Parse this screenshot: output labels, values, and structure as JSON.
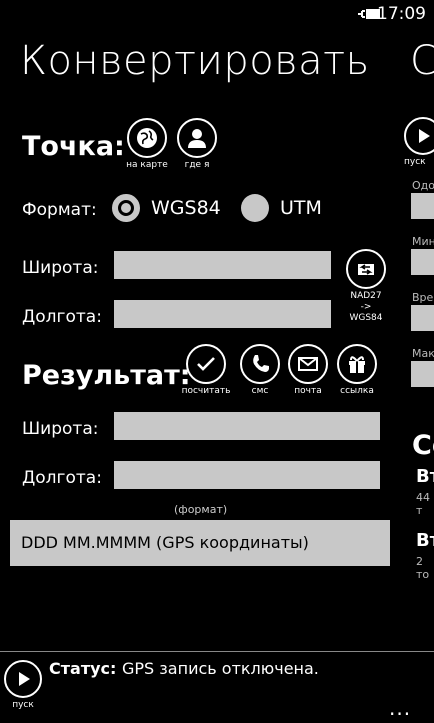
{
  "statusbar": {
    "time": "17:09"
  },
  "page": {
    "title": "Конвертировать",
    "next_title_peek": "С"
  },
  "point": {
    "heading": "Точка:",
    "map_caption": "на карте",
    "me_caption": "где я",
    "format_label": "Формат:",
    "options": [
      "WGS84",
      "UTM"
    ],
    "selected": "WGS84",
    "lat_label": "Широта:",
    "lat_value": "",
    "lon_label": "Долгота:",
    "lon_value": "",
    "datum_caption_1": "NAD27",
    "datum_caption_2": "->",
    "datum_caption_3": "WGS84"
  },
  "result": {
    "heading": "Результат:",
    "actions": [
      "посчитать",
      "смс",
      "почта",
      "ссылка"
    ],
    "lat_label": "Широта:",
    "lat_value": "",
    "lon_label": "Долгота:",
    "lon_value": "",
    "format_hint": "(формат)",
    "format_value": "DDD MM.MMMM (GPS координаты)"
  },
  "peek": {
    "play_caption": "пуск",
    "labels": [
      "Одо",
      "Мин",
      "Врe",
      "Мак"
    ],
    "heading": "Co",
    "items": [
      {
        "title": "Вт",
        "sub": "44 т"
      },
      {
        "title": "Вт",
        "sub": "2 то"
      }
    ]
  },
  "bottom": {
    "play_caption": "пуск",
    "status_label": "Статус:",
    "status_text": "GPS запись отключена.",
    "more": "..."
  },
  "colors": {
    "background": "#000000",
    "foreground": "#ffffff",
    "field": "#c8c8c8"
  }
}
